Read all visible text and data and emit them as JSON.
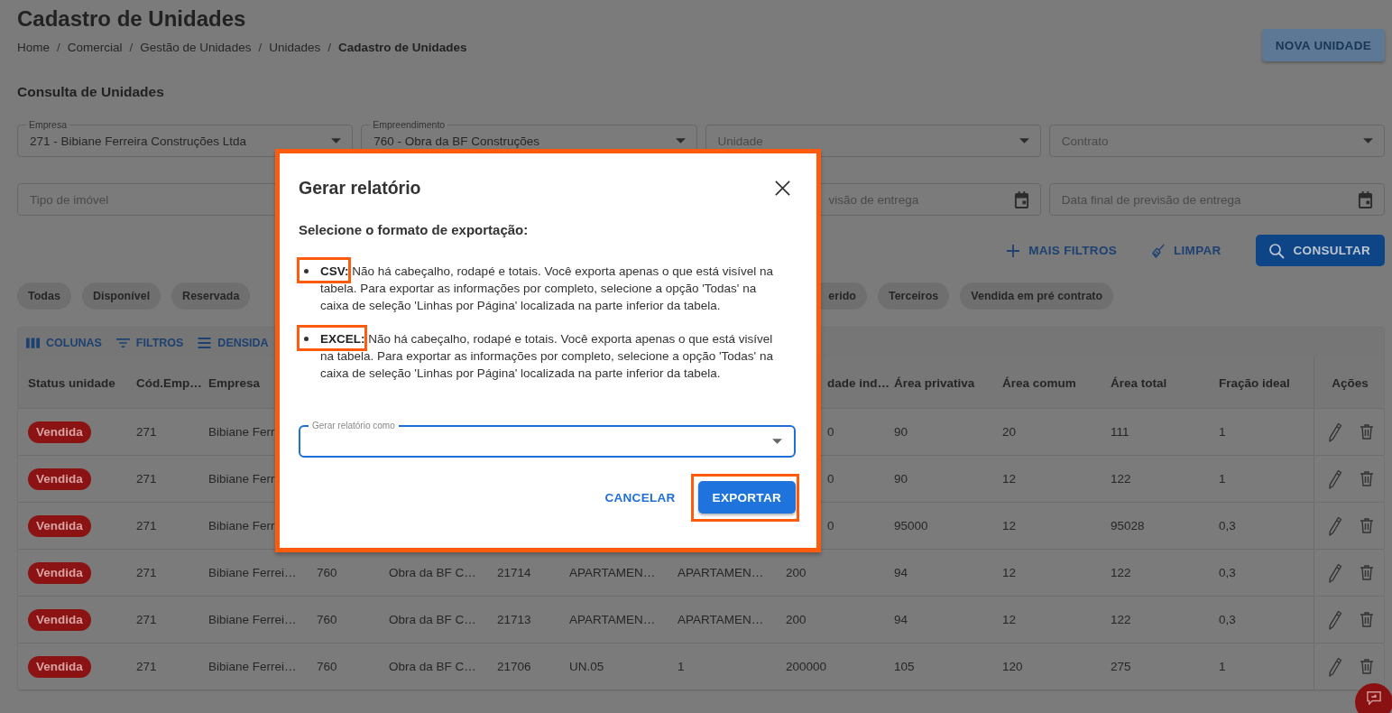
{
  "page": {
    "title": "Cadastro de Unidades",
    "breadcrumb": [
      {
        "label": "Home",
        "separator": "/",
        "current": false
      },
      {
        "label": "Comercial",
        "separator": "/",
        "current": false
      },
      {
        "label": "Gestão de Unidades",
        "separator": "/",
        "current": false
      },
      {
        "label": "Unidades",
        "separator": "/",
        "current": false
      },
      {
        "label": "Cadastro de Unidades",
        "current": true
      }
    ],
    "primary_button": "NOVA UNIDADE",
    "section_title": "Consulta de Unidades",
    "filters": [
      {
        "kind": "select",
        "label": "Empresa",
        "value": "271 - Bibiane Ferreira Construções Ltda"
      },
      {
        "kind": "select",
        "label": "Empreendimento",
        "value": "760 - Obra da BF Construções"
      },
      {
        "kind": "select",
        "placeholder": "Unidade"
      },
      {
        "kind": "select",
        "placeholder": "Contrato"
      },
      {
        "kind": "text",
        "placeholder": "Tipo de imóvel"
      },
      {
        "kind": "date",
        "placeholder": "visão de entrega"
      },
      {
        "kind": "date",
        "placeholder": "Data final de previsão de entrega"
      }
    ],
    "filter_actions": [
      {
        "kind": "add",
        "label": "MAIS FILTROS"
      },
      {
        "kind": "clear",
        "label": "LIMPAR"
      },
      {
        "kind": "search",
        "label": "CONSULTAR"
      }
    ],
    "status_chips": [
      "Todas",
      "Disponível",
      "Reservada",
      "erido",
      "Terceiros",
      "Vendida em pré contrato"
    ],
    "table": {
      "toolbar": [
        {
          "kind": "columns",
          "label": "COLUNAS"
        },
        {
          "kind": "filters",
          "label": "FILTROS"
        },
        {
          "kind": "density",
          "label": "DENSIDA"
        }
      ],
      "columns": [
        {
          "kind": "status",
          "label": "Status unidade"
        },
        {
          "kind": "text",
          "label": "Cód.Emp…"
        },
        {
          "kind": "text",
          "label": "Empresa"
        },
        {
          "kind": "text"
        },
        {
          "kind": "text"
        },
        {
          "kind": "text"
        },
        {
          "kind": "text"
        },
        {
          "kind": "text"
        },
        {
          "kind": "text",
          "label": "dade ind…"
        },
        {
          "kind": "text",
          "label": "Área privativa"
        },
        {
          "kind": "text",
          "label": "Área comum"
        },
        {
          "kind": "text",
          "label": "Área total"
        },
        {
          "kind": "text",
          "label": "Fração ideal"
        },
        {
          "kind": "actions",
          "label": "Ações"
        }
      ],
      "rows": [
        [
          "Vendida",
          "271",
          "Bibiane Ferr",
          null,
          null,
          null,
          null,
          null,
          "0",
          "90",
          "20",
          "111",
          "1"
        ],
        [
          "Vendida",
          "271",
          "Bibiane Ferr",
          null,
          null,
          null,
          null,
          null,
          "0",
          "90",
          "12",
          "122",
          "1"
        ],
        [
          "Vendida",
          "271",
          "Bibiane Ferr",
          null,
          null,
          null,
          null,
          null,
          "0",
          "95000",
          "12",
          "95028",
          "0,3"
        ],
        [
          "Vendida",
          "271",
          "Bibiane Ferrei…",
          "760",
          "Obra da BF C…",
          "21714",
          "APARTAMEN…",
          "APARTAMEN…",
          "200",
          "94",
          "12",
          "122",
          "0,3"
        ],
        [
          "Vendida",
          "271",
          "Bibiane Ferrei…",
          "760",
          "Obra da BF C…",
          "21713",
          "APARTAMEN…",
          "APARTAMEN…",
          "200",
          "94",
          "12",
          "122",
          "0,3"
        ],
        [
          "Vendida",
          "271",
          "Bibiane Ferrei…",
          "760",
          "Obra da BF C…",
          "21706",
          "UN.05",
          "1",
          "200000",
          "105",
          "120",
          "275",
          "1"
        ]
      ]
    }
  },
  "dialog": {
    "title": "Gerar relatório",
    "subtitle": "Selecione o formato de exportação:",
    "formats": [
      {
        "text": "**CSV:** Não há cabeçalho, rodapé e totais. Você exporta apenas o que está visível na tabela. Para exportar as informações por completo, selecione a opção 'Todas' na caixa de seleção 'Linhas por Página' localizada na parte inferior da tabela.",
        "highlighted": true
      },
      {
        "text": "**EXCEL:** Não há cabeçalho, rodapé e totais. Você exporta apenas o que está visível na tabela. Para exportar as informações por completo, selecione a opção 'Todas' na caixa de seleção 'Linhas por Página' localizada na parte inferior da tabela.",
        "highlighted": true
      }
    ],
    "select": {
      "label": "Gerar relatório como",
      "focused": true
    },
    "buttons": [
      {
        "kind": "text",
        "label": "CANCELAR",
        "highlighted": false
      },
      {
        "kind": "contained",
        "label": "EXPORTAR",
        "highlighted": true
      }
    ],
    "highlighted": true
  }
}
